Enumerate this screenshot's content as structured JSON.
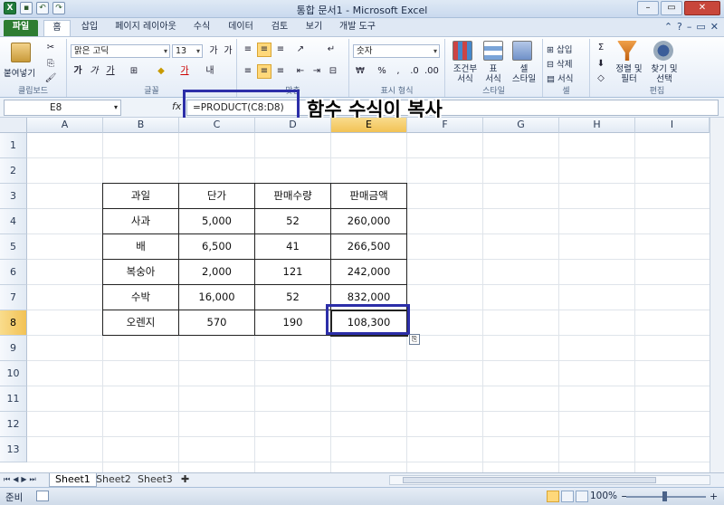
{
  "window": {
    "title": "통합 문서1 - Microsoft Excel",
    "buttons": [
      "–",
      "▭",
      "✕"
    ]
  },
  "quick_access": {
    "undo": "↶",
    "redo": "↷"
  },
  "tabs": [
    "파일",
    "홈",
    "삽입",
    "페이지 레이아웃",
    "수식",
    "데이터",
    "검토",
    "보기",
    "개발 도구"
  ],
  "active_tab": "홈",
  "ribbon": {
    "clipboard": {
      "label": "클립보드",
      "paste": "붙여넣기"
    },
    "font": {
      "label": "글꼴",
      "name": "맑은 고딕",
      "size": "13",
      "bold": "가",
      "italic": "가",
      "underline": "가"
    },
    "alignment": {
      "label": "맞춤"
    },
    "number": {
      "label": "표시 형식",
      "format": "숫자",
      "percent": "%"
    },
    "styles": {
      "label": "스타일",
      "cond_format": "조건부\n서식",
      "table": "표\n서식",
      "cell_style": "셀\n스타일"
    },
    "cells": {
      "label": "셀",
      "insert": "삽입",
      "delete": "삭제",
      "format": "서식"
    },
    "editing": {
      "label": "편집",
      "sort_filter": "정렬 및\n필터",
      "find_select": "찾기 및\n선택"
    }
  },
  "formula_bar": {
    "name_box": "E8",
    "fx": "fx",
    "formula": "=PRODUCT(C8:D8)"
  },
  "overlay_caption": "함수 수식이 복사",
  "columns": [
    "A",
    "B",
    "C",
    "D",
    "E",
    "F",
    "G",
    "H",
    "I"
  ],
  "active_column": "E",
  "rows": [
    "1",
    "2",
    "3",
    "4",
    "5",
    "6",
    "7",
    "8",
    "9",
    "10",
    "11",
    "12",
    "13"
  ],
  "active_row": "8",
  "table": {
    "headers": [
      "과일",
      "단가",
      "판매수량",
      "판매금액"
    ],
    "rows": [
      [
        "사과",
        "5,000",
        "52",
        "260,000"
      ],
      [
        "배",
        "6,500",
        "41",
        "266,500"
      ],
      [
        "복숭아",
        "2,000",
        "121",
        "242,000"
      ],
      [
        "수박",
        "16,000",
        "52",
        "832,000"
      ],
      [
        "오렌지",
        "570",
        "190",
        "108,300"
      ]
    ]
  },
  "sheets": [
    "Sheet1",
    "Sheet2",
    "Sheet3"
  ],
  "active_sheet": "Sheet1",
  "status": {
    "ready": "준비",
    "zoom": "100%"
  },
  "colors": {
    "accent_file": "#2e7d32",
    "selection_box": "#2c2ea8",
    "active_header": "#f2c255"
  }
}
